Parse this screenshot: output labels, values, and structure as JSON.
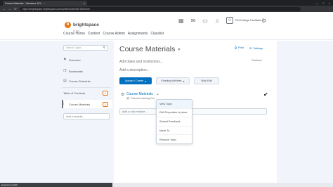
{
  "browser": {
    "tab_title": "Course Materials - Literature 101 - ...",
    "tab_close": "×",
    "url": "https://brightspace.brightspace.com/d2l/le/content/6736/Home",
    "nav_back": "←",
    "nav_forward": "→",
    "nav_reload": "↻",
    "menu": "⋮",
    "window_controls": [
      "—",
      "□",
      "×"
    ]
  },
  "header": {
    "logo_text": "brightspace",
    "logo_sub": "by D2L",
    "user_name": "D2LCollege Facilitator",
    "nav_items": [
      "Course Home",
      "Content",
      "Course Admin",
      "Assignments",
      "Classlist"
    ],
    "icons": [
      "grid-icon",
      "mail-icon",
      "chat-icon",
      "bell-icon"
    ]
  },
  "sidebar": {
    "search_placeholder": "Search Topics",
    "items": [
      {
        "label": "Overview",
        "icon": "overview-icon"
      },
      {
        "label": "Bookmarks",
        "icon": "bookmark-icon"
      },
      {
        "label": "Course Schedule",
        "icon": "calendar-icon"
      }
    ],
    "toc_label": "Table of Contents",
    "toc_count": "1",
    "module_label": "Course Materials",
    "module_count": "1",
    "add_module_placeholder": "Add a module..."
  },
  "main": {
    "title": "Course Materials",
    "print_label": "Print",
    "settings_label": "Settings",
    "dates_text": "Add dates and restrictions...",
    "description_text": "Add a description...",
    "published_label": "Published",
    "upload_button": "Upload / Create",
    "existing_button": "Existing Activities",
    "bulk_button": "Bulk Edit",
    "topic_title": "Course Materials",
    "topic_sub": "External Learning Tool",
    "add_submodule": "Add a sub-module..."
  },
  "menu": {
    "items": [
      "View Topic",
      "Edit Properties In-place",
      "Submit Feedback",
      "Move To",
      "Remove Topic"
    ]
  },
  "status": {
    "text": "javascript:void(0);"
  }
}
